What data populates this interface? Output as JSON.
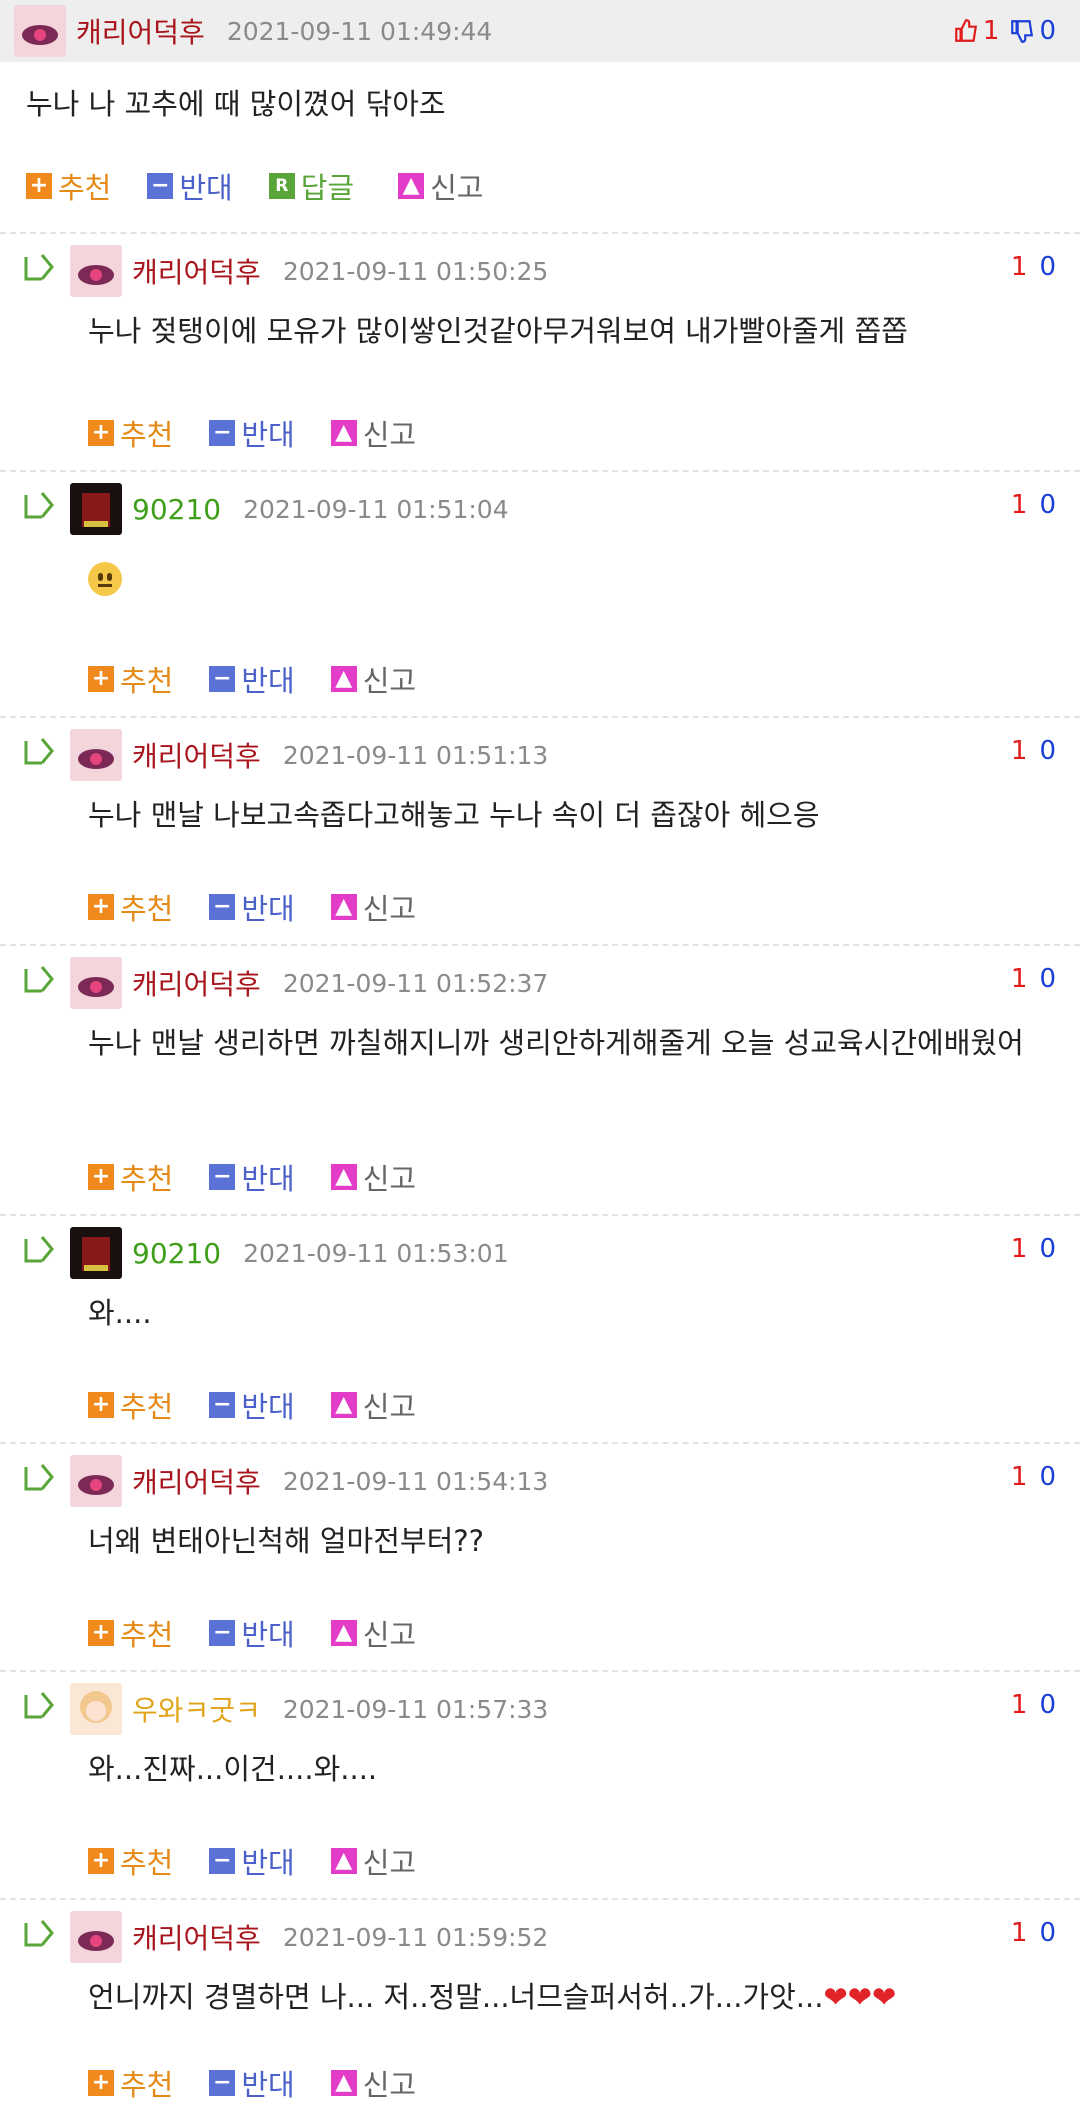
{
  "post": {
    "nickname": "캐리어덕후",
    "date": "2021-09-11 01:49:44",
    "up": "1",
    "down": "0",
    "body": "누나 나 꼬추에 때 많이꼈어 닦아조",
    "actions": {
      "recommend": "추천",
      "oppose": "반대",
      "reply": "답글",
      "report": "신고"
    }
  },
  "comments": [
    {
      "nickname": "캐리어덕후",
      "date": "2021-09-11 01:50:25",
      "up": "1",
      "down": "0",
      "body": "누나 젖탱이에 모유가 많이쌓인것같아무거워보여 내가빨아줄게 쫍쫍"
    },
    {
      "nickname": "90210",
      "date": "2021-09-11 01:51:04",
      "up": "1",
      "down": "0",
      "body": "",
      "emoji": "neutral-face"
    },
    {
      "nickname": "캐리어덕후",
      "date": "2021-09-11 01:51:13",
      "up": "1",
      "down": "0",
      "body": "누나 맨날 나보고속좁다고해놓고 누나 속이 더 좁잖아 헤으응"
    },
    {
      "nickname": "캐리어덕후",
      "date": "2021-09-11 01:52:37",
      "up": "1",
      "down": "0",
      "body": "누나 맨날 생리하면 까칠해지니까 생리안하게해줄게 오늘 성교육시간에배웠어"
    },
    {
      "nickname": "90210",
      "date": "2021-09-11 01:53:01",
      "up": "1",
      "down": "0",
      "body": "와...."
    },
    {
      "nickname": "캐리어덕후",
      "date": "2021-09-11 01:54:13",
      "up": "1",
      "down": "0",
      "body": "너왜 변태아닌척해 얼마전부터??"
    },
    {
      "nickname": "우와ㅋ굿ㅋ",
      "date": "2021-09-11 01:57:33",
      "up": "1",
      "down": "0",
      "body": "와...진짜...이건....와...."
    },
    {
      "nickname": "캐리어덕후",
      "date": "2021-09-11 01:59:52",
      "up": "1",
      "down": "0",
      "body": "언니까지 경멸하면 나... 저..정말...너므슬퍼서허..가...가앗...",
      "hearts": "❤❤❤"
    }
  ],
  "colors": {
    "up": "#e11b1b",
    "down": "#1a3fd8",
    "recommend": "#f08a1c",
    "oppose": "#5a71d6",
    "reply": "#5aa53a",
    "report": "#e23cc8"
  }
}
